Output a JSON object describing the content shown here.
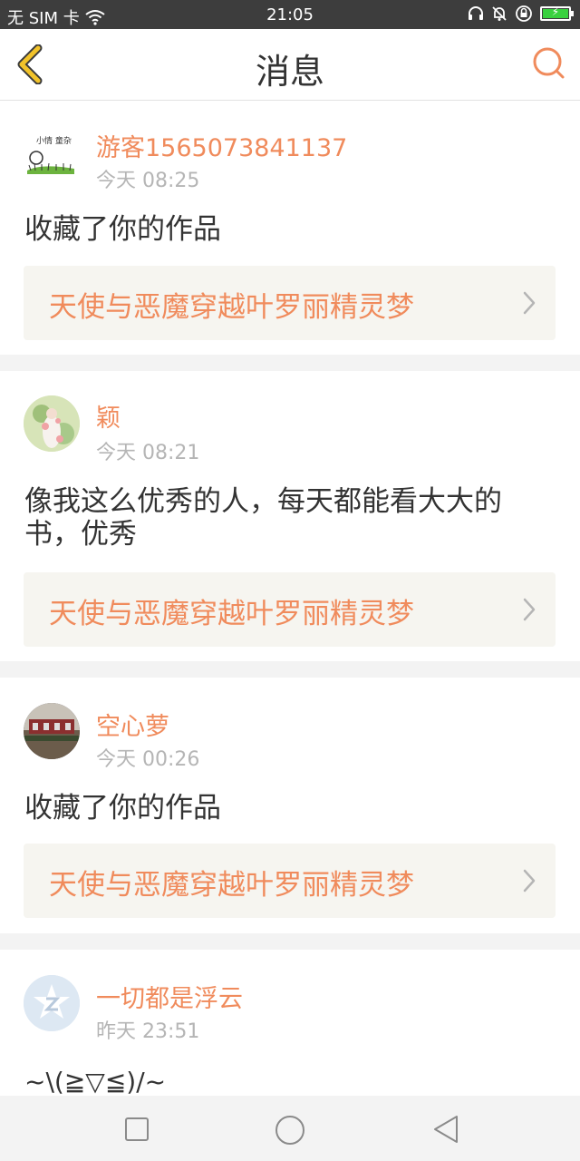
{
  "status_bar": {
    "carrier": "无 SIM 卡",
    "time": "21:05"
  },
  "header": {
    "title": "消息"
  },
  "messages": [
    {
      "user": "游客1565073841137",
      "time": "今天 08:25",
      "text": "收藏了你的作品",
      "work": "天使与恶魔穿越叶罗丽精灵梦",
      "avatar_text": "小情 童杂"
    },
    {
      "user": "颖",
      "time": "今天 08:21",
      "text": "像我这么优秀的人，每天都能看大大的书，优秀",
      "work": "天使与恶魔穿越叶罗丽精灵梦"
    },
    {
      "user": "空心萝",
      "time": "今天 00:26",
      "text": "收藏了你的作品",
      "work": "天使与恶魔穿越叶罗丽精灵梦"
    },
    {
      "user": "一切都是浮云",
      "time": "昨天 23:51",
      "text": "~\\(≧▽≦)/~"
    }
  ],
  "colors": {
    "accent": "#f08b5c",
    "status_bar": "#3d3d3d",
    "back_arrow": "#f2c32a"
  }
}
